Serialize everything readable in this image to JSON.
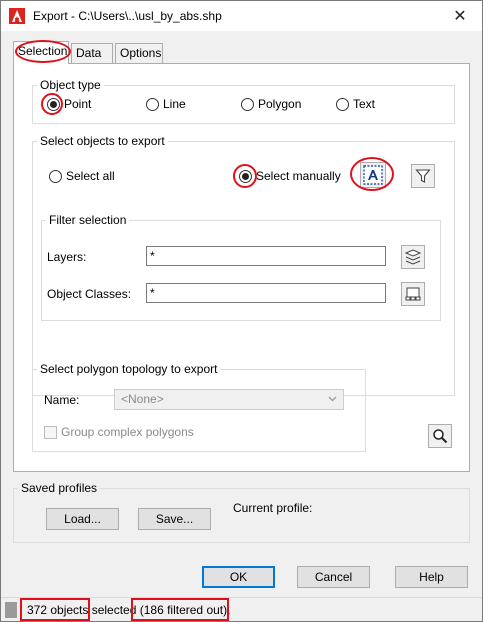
{
  "window": {
    "title": "Export - C:\\Users\\..\\usl_by_abs.shp",
    "close_glyph": "✕"
  },
  "tabs": [
    {
      "label": "Selection",
      "active": true
    },
    {
      "label": "Data",
      "active": false
    },
    {
      "label": "Options",
      "active": false
    }
  ],
  "object_type": {
    "legend": "Object type",
    "options": [
      {
        "label": "Point",
        "selected": true
      },
      {
        "label": "Line",
        "selected": false
      },
      {
        "label": "Polygon",
        "selected": false
      },
      {
        "label": "Text",
        "selected": false
      }
    ]
  },
  "select_objects": {
    "legend": "Select objects to export",
    "select_all_label": "Select all",
    "select_manually_label": "Select manually",
    "selected_option": "Select manually",
    "select_objects_icon": "select-objects-icon",
    "quick_select_icon": "filter-funnel-icon"
  },
  "filter_selection": {
    "legend": "Filter selection",
    "layers_label": "Layers:",
    "layers_value": "*",
    "layers_icon": "layers-stack-icon",
    "classes_label": "Object Classes:",
    "classes_value": "*",
    "classes_icon": "object-classes-icon"
  },
  "polygon_topology": {
    "legend": "Select polygon topology to export",
    "name_label": "Name:",
    "name_value": "<None>",
    "group_complex_label": "Group complex polygons",
    "zoom_icon": "magnifier-icon"
  },
  "saved_profiles": {
    "legend": "Saved profiles",
    "load_label": "Load...",
    "save_label": "Save...",
    "current_profile_label": "Current profile:"
  },
  "buttons": {
    "ok_label": "OK",
    "cancel_label": "Cancel",
    "help_label": "Help"
  },
  "status": {
    "count_text": "372 objects selected",
    "filtered_text": " (186 filtered out)."
  },
  "colors": {
    "annotation_red": "#e0101a",
    "default_button_border": "#0078d7",
    "app_icon_red": "#d9251d"
  }
}
